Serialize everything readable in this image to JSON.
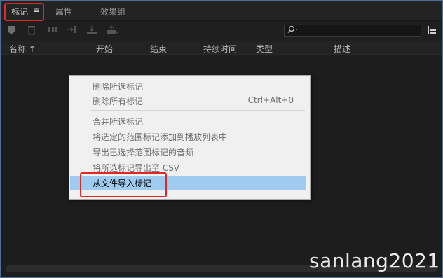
{
  "tabs": [
    {
      "label": "标记"
    },
    {
      "label": "属性"
    },
    {
      "label": "效果组"
    }
  ],
  "tab_menu_glyph": "≡",
  "toolbar_icons": [
    "marker-icon",
    "trash-icon",
    "distribute-icon",
    "import-icon",
    "align-icon",
    "export-icon"
  ],
  "search": {
    "value": "",
    "icon": "search-icon"
  },
  "columns": [
    {
      "label": "名称 ↑"
    },
    {
      "label": "开始"
    },
    {
      "label": "结束"
    },
    {
      "label": "持续时间"
    },
    {
      "label": "类型"
    },
    {
      "label": "描述"
    }
  ],
  "context_menu": {
    "items": [
      {
        "label": "删除所选标记",
        "shortcut": ""
      },
      {
        "label": "删除所有标记",
        "shortcut": "Ctrl+Alt+0"
      },
      {
        "label": "合并所选标记",
        "shortcut": ""
      },
      {
        "label": "将选定的范围标记添加到播放列表中",
        "shortcut": ""
      },
      {
        "label": "导出已选择范围标记的音频",
        "shortcut": ""
      },
      {
        "label": "将所选标记导出至 CSV",
        "shortcut": ""
      },
      {
        "label": "从文件导入标记",
        "shortcut": ""
      }
    ]
  },
  "watermark": "sanlang2021",
  "colors": {
    "panel_bg": "#1d1d1d",
    "menu_bg": "#f0f0f0",
    "hover_bg": "#9fcbf0",
    "annotation_red": "#e32626"
  }
}
